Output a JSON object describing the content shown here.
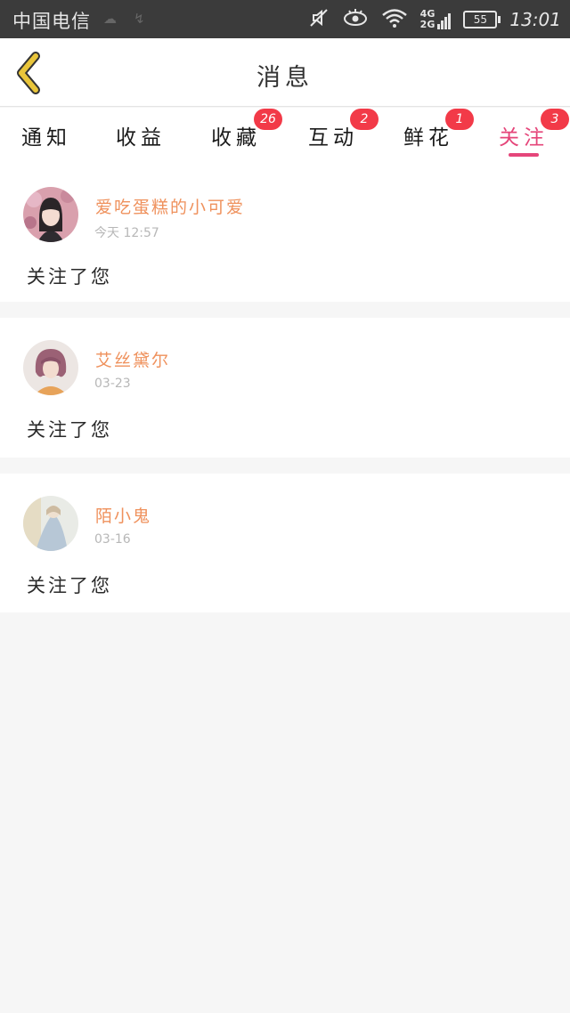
{
  "status_bar": {
    "carrier": "中国电信",
    "network_top": "4G",
    "network_bottom": "2G",
    "battery": "55",
    "time": "13:01",
    "icons": [
      "mute-icon",
      "eye-icon",
      "wifi-icon",
      "signal-icon",
      "battery-icon"
    ]
  },
  "header": {
    "title": "消息",
    "back_icon": "chevron-left-icon",
    "accent": "#e9c53a"
  },
  "tabs": [
    {
      "label": "通知",
      "badge": ""
    },
    {
      "label": "收益",
      "badge": ""
    },
    {
      "label": "收藏",
      "badge": "26"
    },
    {
      "label": "互动",
      "badge": "2"
    },
    {
      "label": "鲜花",
      "badge": "1"
    },
    {
      "label": "关注",
      "badge": "3"
    }
  ],
  "active_tab": "关注",
  "colors": {
    "active_tab": "#e5467a",
    "badge": "#f23a48",
    "username": "#ef915c"
  },
  "notifications": [
    {
      "username": "爱吃蛋糕的小可爱",
      "time": "今天 12:57",
      "message": "关注了您"
    },
    {
      "username": "艾丝黛尔",
      "time": "03-23",
      "message": "关注了您"
    },
    {
      "username": "陌小鬼",
      "time": "03-16",
      "message": "关注了您"
    }
  ]
}
